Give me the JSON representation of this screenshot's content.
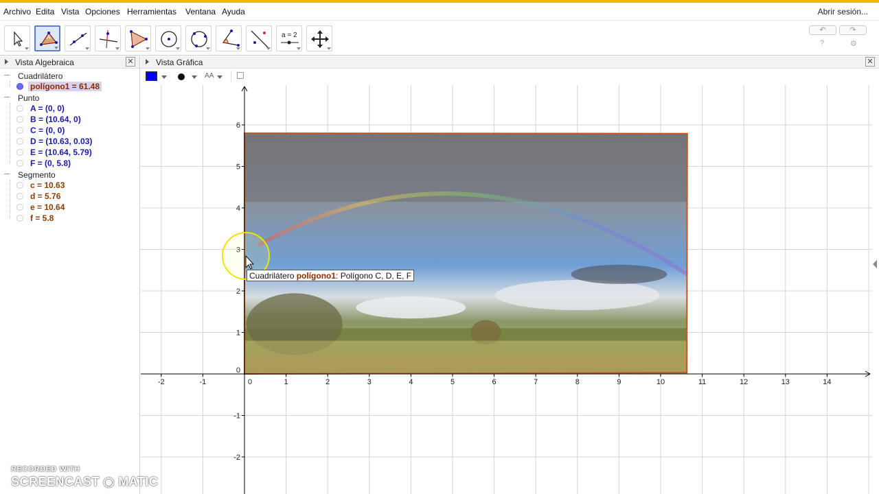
{
  "menu": {
    "items": [
      "Archivo",
      "Edita",
      "Vista",
      "Opciones",
      "Herramientas",
      "Ventana",
      "Ayuda"
    ],
    "login": "Abrir sesión..."
  },
  "toolbar": {
    "tools": [
      "move-tool",
      "polygon-tool",
      "line-tool",
      "perpendicular-tool",
      "polygon-triangle-tool",
      "circle-center-tool",
      "circle-three-points-tool",
      "angle-tool",
      "reflect-tool",
      "slider-tool",
      "move-view-tool"
    ],
    "active_tool": "polygon-tool",
    "slider_label": "a = 2",
    "undo": "↶",
    "redo": "↷",
    "help": "?",
    "settings": "⚙"
  },
  "algebra": {
    "title": "Vista Algebraica",
    "groups": [
      {
        "name": "Cuadrilátero",
        "items": [
          {
            "label": "polígono1 = 61.48",
            "kind": "poly",
            "visible": true,
            "selected": true
          }
        ]
      },
      {
        "name": "Punto",
        "items": [
          {
            "label": "A = (0, 0)",
            "kind": "point",
            "visible": false
          },
          {
            "label": "B = (10.64, 0)",
            "kind": "point",
            "visible": false
          },
          {
            "label": "C = (0, 0)",
            "kind": "point",
            "visible": false
          },
          {
            "label": "D = (10.63, 0.03)",
            "kind": "point",
            "visible": false
          },
          {
            "label": "E = (10.64, 5.79)",
            "kind": "point",
            "visible": false
          },
          {
            "label": "F = (0, 5.8)",
            "kind": "point",
            "visible": false
          }
        ]
      },
      {
        "name": "Segmento",
        "items": [
          {
            "label": "c = 10.63",
            "kind": "seg",
            "visible": false
          },
          {
            "label": "d = 5.76",
            "kind": "seg",
            "visible": false
          },
          {
            "label": "e = 10.64",
            "kind": "seg",
            "visible": false
          },
          {
            "label": "f = 5.8",
            "kind": "seg",
            "visible": false
          }
        ]
      }
    ]
  },
  "graphics": {
    "title": "Vista Gráfica",
    "style_bar": {
      "color": "#0000ff",
      "text_size": "AA"
    },
    "x_ticks": [
      "-2",
      "-1",
      "0",
      "1",
      "2",
      "3",
      "4",
      "5",
      "6",
      "7",
      "8",
      "9",
      "10",
      "11",
      "12",
      "13",
      "14"
    ],
    "y_ticks": [
      "-2",
      "-1",
      "0",
      "1",
      "2",
      "3",
      "4",
      "5",
      "6"
    ],
    "polygon": {
      "name": "polígono1",
      "vertices": [
        [
          0,
          0
        ],
        [
          10.63,
          0.03
        ],
        [
          10.64,
          5.79
        ],
        [
          0,
          5.8
        ]
      ],
      "area": 61.48
    },
    "tooltip": {
      "prefix": "Cuadrilátero ",
      "name": "polígono1",
      "suffix": ": Polígono C, D, E, F"
    }
  },
  "watermark": {
    "line1": "RECORDED WITH",
    "line2": "SCREENCAST ◉ MATIC"
  },
  "colors": {
    "accent": "#f5b400",
    "polygon_edge": "#c2571e",
    "axis": "#000000"
  }
}
